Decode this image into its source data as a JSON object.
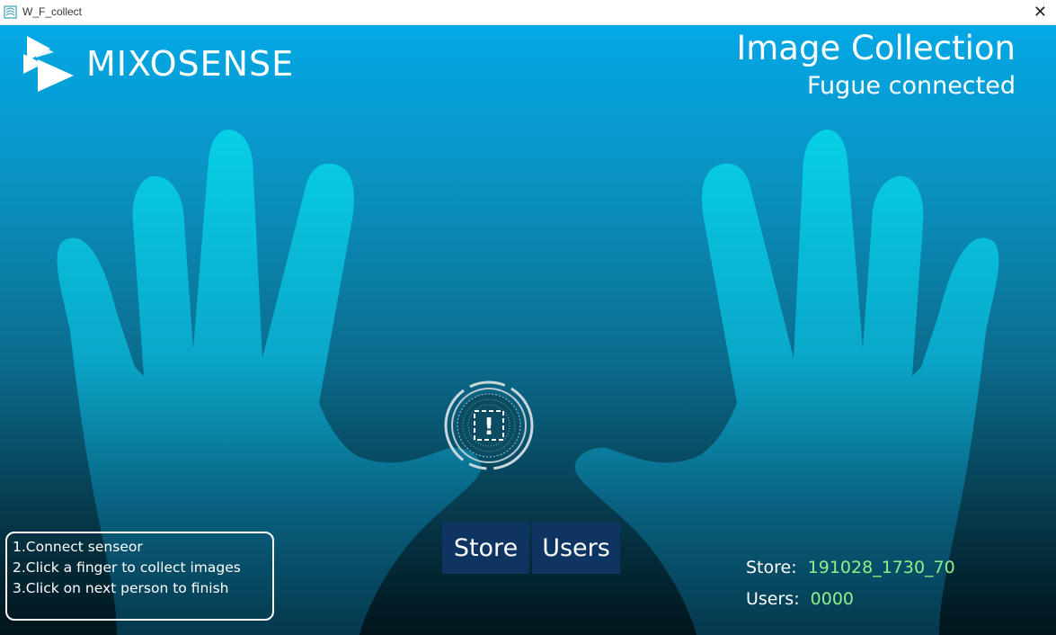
{
  "window": {
    "title": "W_F_collect",
    "close_glyph": "✕",
    "app_icon": "app-icon"
  },
  "header": {
    "logo_text": "MIXOSENSE",
    "logo_icon": "mixosense-logo-icon",
    "title": "Image Collection",
    "status": "Fugue connected"
  },
  "center": {
    "icon": "fingerprint-alert-icon",
    "glyph": "!"
  },
  "buttons": {
    "store_label": "Store",
    "users_label": "Users"
  },
  "instructions": [
    "1.Connect senseor",
    "2.Click a finger to collect images",
    "3.Click on next person to finish"
  ],
  "stats": {
    "store_label": "Store:",
    "store_value": "191028_1730_70",
    "users_label": "Users:",
    "users_value": "0000"
  },
  "colors": {
    "accent_green": "#8ef08a",
    "button_bg": "#0e3561",
    "bg_top": "#03a8e6"
  }
}
